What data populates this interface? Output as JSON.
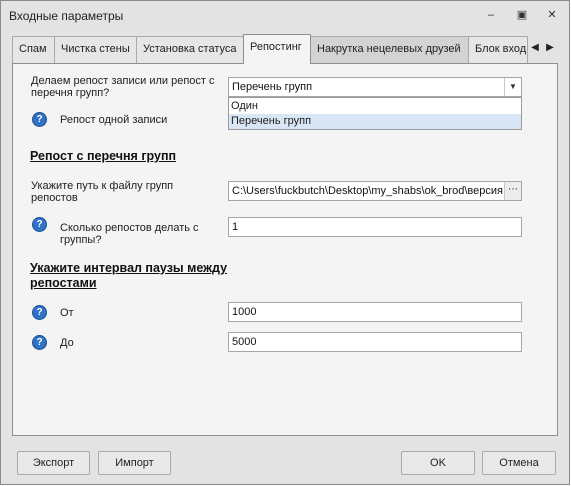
{
  "window": {
    "title": "Входные параметры"
  },
  "tabs": [
    {
      "label": "Спам"
    },
    {
      "label": "Чистка стены"
    },
    {
      "label": "Установка статуса"
    },
    {
      "label": "Репостинг"
    },
    {
      "label": "Накрутка нецелевых друзей"
    },
    {
      "label": "Блок вход"
    }
  ],
  "form": {
    "mode_label": "Делаем репост записи или репост с перечня групп?",
    "mode_value": "Перечень групп",
    "mode_options": [
      "Один",
      "Перечень групп"
    ],
    "single_repost_label": "Репост одной записи",
    "section_groups": "Репост с перечня групп",
    "path_label": "Укажите путь к файлу групп репостов",
    "path_value": "C:\\Users\\fuckbutch\\Desktop\\my_shabs\\ok_brod\\версия",
    "count_label": "Сколько репостов делать с группы?",
    "count_value": "1",
    "section_interval": "Укажите интервал паузы между репостами",
    "from_label": "От",
    "from_value": "1000",
    "to_label": "До",
    "to_value": "5000"
  },
  "buttons": {
    "export": "Экспорт",
    "import": "Импорт",
    "ok": "OK",
    "cancel": "Отмена"
  }
}
